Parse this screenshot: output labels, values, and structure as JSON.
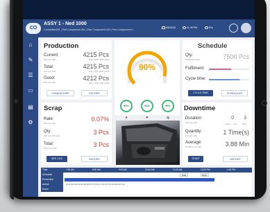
{
  "header": {
    "logo": "CO",
    "title": "ASSY 1 - Ned 1000",
    "subtitle": "ComboBox001 | Part Component 001 | Part Component 002 | Part Component 0...",
    "items": [
      "6/6/2015",
      "11:45 PM",
      "Eric"
    ]
  },
  "sidebar": {
    "icons": [
      "home-icon",
      "wrench-icon",
      "list-icon",
      "monitor-icon",
      "document-icon",
      "settings-icon"
    ]
  },
  "production": {
    "title": "Production",
    "rows": [
      {
        "label": "Current:",
        "sub": "Part per shift",
        "value": "4215 Pcs",
        "detail": "4215 | 1040 | 1040 | 1040"
      },
      {
        "label": "Total:",
        "sub": "Part per shift",
        "value": "4215 Pcs",
        "detail": "4215 | 1040 | 1040 | 1040"
      },
      {
        "label": "Good:",
        "sub": "Part per shift",
        "value": "4212 Pcs",
        "detail": "4212 | 1040 | 1040 | 1040"
      }
    ],
    "buttons": [
      "CHANGEOVER",
      "HISTORY"
    ]
  },
  "oee": {
    "value": "90%",
    "percent": 90,
    "rings": [
      {
        "value": "90%",
        "label": "A"
      },
      {
        "value": "91%",
        "label": "P"
      },
      {
        "value": "99%",
        "label": "Q"
      }
    ]
  },
  "schedule": {
    "title": "Schedule",
    "qty_label": "Qty:",
    "qty_sub": "Production Part",
    "qty_value": "7500 Pcs",
    "fulfill_label": "Fulfilment:",
    "fulfill_fraction": 0.56,
    "cycle_label": "Cycle time:",
    "cycle_fraction": 0.75,
    "buttons": [
      "CYCLE TIME",
      "SCHEDULER"
    ]
  },
  "scrap": {
    "title": "Scrap",
    "rows": [
      {
        "label": "Rate:",
        "sub": "Part per shift",
        "value": "0.07%"
      },
      {
        "label": "Qty:",
        "sub": "Part per shift part",
        "value": "3 Pcs"
      },
      {
        "label": "Total:",
        "sub": "Parts per shift",
        "value": "3 Pcs"
      }
    ],
    "buttons": [
      "SEE LIVE",
      "HISTORY"
    ]
  },
  "downtime": {
    "title": "Downtime",
    "rows": [
      {
        "label": "Duration:",
        "sub": "Part per shift",
        "values": [
          "0",
          "3"
        ],
        "units": [
          "Days",
          "Hrs",
          "Mins"
        ]
      },
      {
        "label": "Quantity:",
        "sub": "Part per shift",
        "value": "1 Time(s)"
      },
      {
        "label": "Average:",
        "sub": "Duration per shift",
        "value": "3.88 Min"
      }
    ],
    "buttons": [
      "START",
      "HISTORY"
    ]
  },
  "timeline": {
    "rows": [
      "Time",
      "Schedule",
      "Production",
      "Actual",
      "Down"
    ],
    "ticks": [
      "7:00 AM",
      "8:00 AM",
      "9:00 AM",
      "10:00 AM",
      "11:00 AM",
      "12:00 PM",
      "1:00 PM"
    ],
    "badges": [
      "TASK",
      "BUSY"
    ],
    "numbers": "46  48  264  140  46  69  266  256  53  213  53  42  103  479  270  211  264  207  221"
  },
  "colors": {
    "header": "#2d4b86",
    "accent_red": "#e03a2e",
    "gauge": "#f2a400",
    "ok_green": "#3cb878",
    "fulfill_bar": "#e05a8a",
    "cycle_bar": "#6c8fd6",
    "production_bar": "#2f57c8"
  }
}
